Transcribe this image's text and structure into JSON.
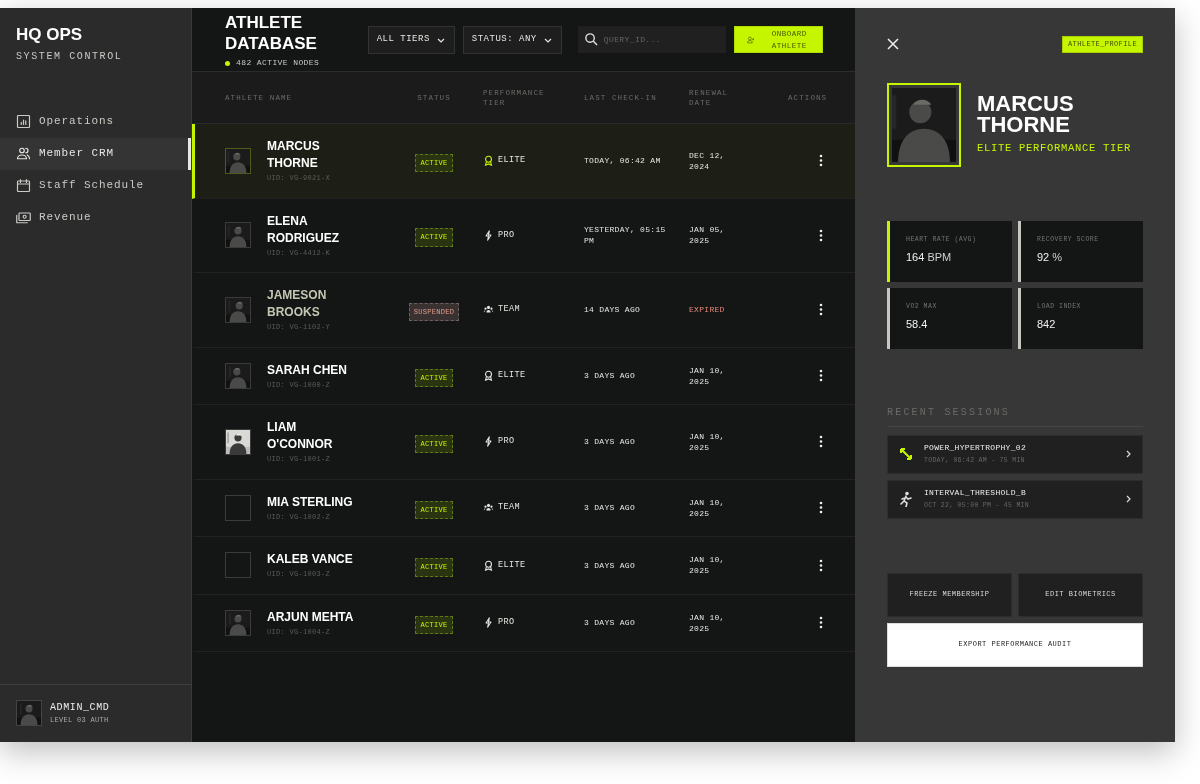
{
  "sidebar": {
    "brand": "HQ OPS",
    "subtitle": "SYSTEM CONTROL",
    "items": [
      {
        "label": "Operations",
        "selected": false
      },
      {
        "label": "Member CRM",
        "selected": true
      },
      {
        "label": "Staff Schedule",
        "selected": false
      },
      {
        "label": "Revenue",
        "selected": false
      }
    ],
    "user": {
      "name": "ADMIN_CMD",
      "role": "LEVEL 03 AUTH"
    }
  },
  "header": {
    "title": "ATHLETE DATABASE",
    "status": "482 ACTIVE NODES",
    "filters": [
      "ALL TIERS",
      "STATUS: ANY"
    ],
    "search": {
      "placeholder": "QUERY_ID..."
    },
    "button": "ONBOARD ATHLETE"
  },
  "table": {
    "columns": [
      "ATHLETE NAME",
      "STATUS",
      "PERFORMANCE TIER",
      "LAST CHECK-IN",
      "RENEWAL DATE",
      "ACTIONS"
    ],
    "rows": [
      {
        "name": "MARCUS THORNE",
        "uid": "UID: VG-9021-X",
        "photo": true,
        "status": {
          "label": "ACTIVE",
          "kind": "active"
        },
        "tier": {
          "label": "ELITE",
          "kind": "elite"
        },
        "check_in": "TODAY, 06:42 AM",
        "renewal": {
          "text": "DEC 12, 2024",
          "expired": false
        },
        "selected": true
      },
      {
        "name": "ELENA RODRIGUEZ",
        "uid": "UID: VG-4412-K",
        "photo": true,
        "status": {
          "label": "ACTIVE",
          "kind": "active"
        },
        "tier": {
          "label": "PRO",
          "kind": "pro"
        },
        "check_in": "YESTERDAY, 05:15 PM",
        "renewal": {
          "text": "JAN 05, 2025",
          "expired": false
        },
        "selected": false
      },
      {
        "name": "JAMESON BROOKS",
        "uid": "UID: VG-1102-Y",
        "photo": true,
        "status": {
          "label": "SUSPENDED",
          "kind": "suspended"
        },
        "tier": {
          "label": "TEAM",
          "kind": "team"
        },
        "check_in": "14 DAYS AGO",
        "renewal": {
          "text": "EXPIRED",
          "expired": true
        },
        "selected": false
      },
      {
        "name": "SARAH CHEN",
        "uid": "UID: VG-1000-Z",
        "photo": true,
        "status": {
          "label": "ACTIVE",
          "kind": "active"
        },
        "tier": {
          "label": "ELITE",
          "kind": "elite"
        },
        "check_in": "3 DAYS AGO",
        "renewal": {
          "text": "JAN 10, 2025",
          "expired": false
        },
        "selected": false
      },
      {
        "name": "LIAM O'CONNOR",
        "uid": "UID: VG-1001-Z",
        "photo": true,
        "status": {
          "label": "ACTIVE",
          "kind": "active"
        },
        "tier": {
          "label": "PRO",
          "kind": "pro"
        },
        "check_in": "3 DAYS AGO",
        "renewal": {
          "text": "JAN 10, 2025",
          "expired": false
        },
        "selected": false
      },
      {
        "name": "MIA STERLING",
        "uid": "UID: VG-1002-Z",
        "photo": false,
        "status": {
          "label": "ACTIVE",
          "kind": "active"
        },
        "tier": {
          "label": "TEAM",
          "kind": "team"
        },
        "check_in": "3 DAYS AGO",
        "renewal": {
          "text": "JAN 10, 2025",
          "expired": false
        },
        "selected": false
      },
      {
        "name": "KALEB VANCE",
        "uid": "UID: VG-1003-Z",
        "photo": false,
        "status": {
          "label": "ACTIVE",
          "kind": "active"
        },
        "tier": {
          "label": "ELITE",
          "kind": "elite"
        },
        "check_in": "3 DAYS AGO",
        "renewal": {
          "text": "JAN 10, 2025",
          "expired": false
        },
        "selected": false
      },
      {
        "name": "ARJUN MEHTA",
        "uid": "UID: VG-1004-Z",
        "photo": true,
        "status": {
          "label": "ACTIVE",
          "kind": "active"
        },
        "tier": {
          "label": "PRO",
          "kind": "pro"
        },
        "check_in": "3 DAYS AGO",
        "renewal": {
          "text": "JAN 10, 2025",
          "expired": false
        },
        "selected": false
      }
    ]
  },
  "profile": {
    "tag": "ATHLETE_PROFILE",
    "name": "MARCUS THORNE",
    "tier": "ELITE PERFORMANCE TIER",
    "metrics": [
      {
        "label": "HEART RATE (AVG)",
        "value": "164",
        "unit": "BPM",
        "highlighted": true
      },
      {
        "label": "RECOVERY SCORE",
        "value": "92",
        "unit": "%",
        "highlighted": false
      },
      {
        "label": "VO2 MAX",
        "value": "58.4",
        "highlighted": false
      },
      {
        "label": "LOAD INDEX",
        "value": "842",
        "highlighted": false
      }
    ],
    "sessions_title": "RECENT SESSIONS",
    "sessions": [
      {
        "name": "POWER_HYPERTROPHY_02",
        "meta": "TODAY, 06:42 AM - 75 MIN",
        "kind": "strength"
      },
      {
        "name": "INTERVAL_THRESHOLD_B",
        "meta": "OCT 22, 05:00 PM - 45 MIN",
        "kind": "run"
      }
    ],
    "actions": [
      {
        "label": "FREEZE MEMBERSHIP",
        "kind": "secondary"
      },
      {
        "label": "EDIT BIOMETRICS",
        "kind": "secondary"
      },
      {
        "label": "EXPORT PERFORMANCE AUDIT",
        "kind": "primary"
      }
    ]
  }
}
